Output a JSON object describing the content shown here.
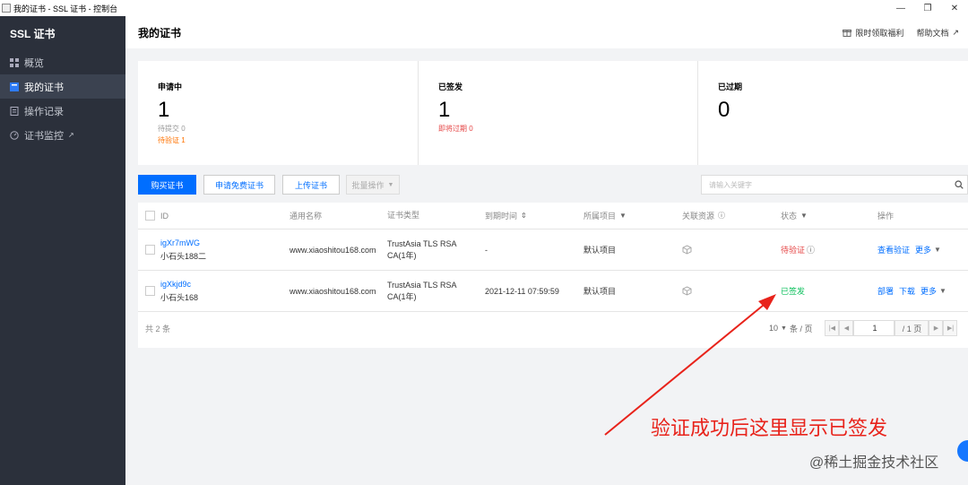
{
  "titlebar": {
    "title": "我的证书 - SSL 证书 - 控制台",
    "minimize": "—",
    "restore": "❐",
    "close": "✕"
  },
  "sidebar": {
    "brand": "SSL 证书",
    "items": [
      {
        "label": "概览",
        "icon": "grid-icon"
      },
      {
        "label": "我的证书",
        "icon": "certificate-icon",
        "active": true
      },
      {
        "label": "操作记录",
        "icon": "record-icon"
      },
      {
        "label": "证书监控",
        "icon": "monitor-icon",
        "external": true
      }
    ]
  },
  "header": {
    "title": "我的证书",
    "promo": "限时领取福利",
    "help": "帮助文档"
  },
  "stats": [
    {
      "label": "申请中",
      "value": "1",
      "sub1": "待提交 0",
      "sub2": "待验证 1"
    },
    {
      "label": "已签发",
      "value": "1",
      "sub1": "即将过期 0"
    },
    {
      "label": "已过期",
      "value": "0"
    }
  ],
  "toolbar": {
    "buy": "购买证书",
    "apply_free": "申请免费证书",
    "upload": "上传证书",
    "batch": "批量操作",
    "search_placeholder": "请输入关键字"
  },
  "table": {
    "headers": {
      "id": "ID",
      "name": "通用名称",
      "type": "证书类型",
      "expiry": "到期时间",
      "project": "所属项目",
      "resource": "关联资源",
      "status": "状态",
      "ops": "操作"
    },
    "rows": [
      {
        "id": "igXr7mWG",
        "alias": "小石头188二",
        "name": "www.xiaoshitou168.com",
        "type": "TrustAsia TLS RSA CA(1年)",
        "expiry": "-",
        "project": "默认项目",
        "status": "待验证",
        "ops": [
          "查看验证",
          "更多"
        ]
      },
      {
        "id": "igXkjd9c",
        "alias": "小石头168",
        "name": "www.xiaoshitou168.com",
        "type": "TrustAsia TLS RSA CA(1年)",
        "expiry": "2021-12-11 07:59:59",
        "project": "默认项目",
        "status": "已签发",
        "ops": [
          "部署",
          "下载",
          "更多"
        ]
      }
    ],
    "total": "共 2 条",
    "page_size": "10",
    "page_size_unit": "条 / 页",
    "current_page": "1",
    "total_pages": "/ 1 页"
  },
  "annotation": {
    "text": "验证成功后这里显示已签发",
    "color": "#e8231b"
  },
  "watermark": "@稀土掘金技术社区",
  "colors": {
    "primary": "#006eff",
    "sidebar_bg": "#2b303b",
    "pending": "#e54545",
    "issued": "#0abf5b",
    "warning": "#ff7200"
  }
}
